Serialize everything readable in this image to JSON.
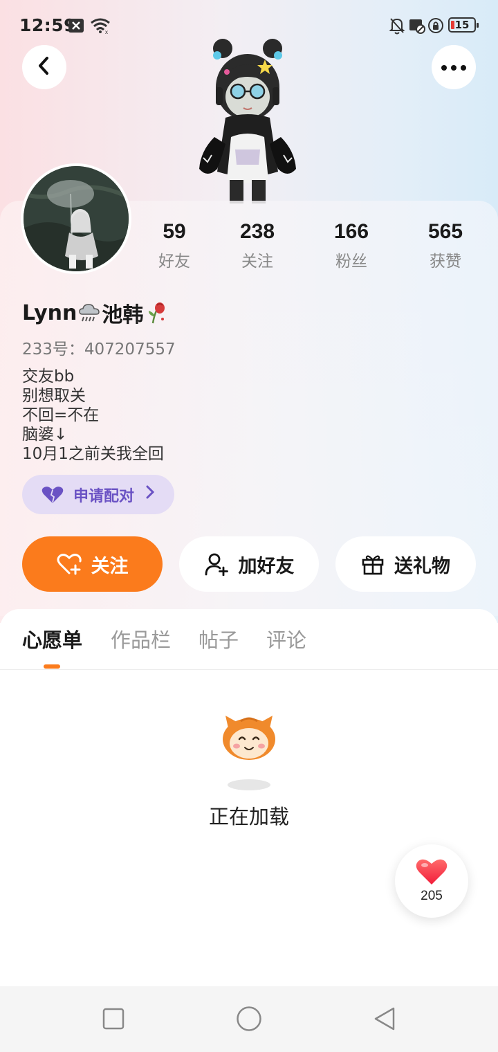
{
  "status_bar": {
    "time": "12:59",
    "battery_level": "15",
    "icons": [
      "close-box-icon",
      "wifi-icon",
      "mute-bell-icon",
      "screenshot-card-icon",
      "rotation-lock-icon",
      "battery-icon"
    ]
  },
  "header": {
    "back_icon": "chevron-left-icon",
    "more_icon": "more-dots-icon"
  },
  "profile": {
    "username": "Lynn",
    "username_suffix": "池韩",
    "id_text": "233号：407207557",
    "bio": [
      "交友bb",
      "别想取关",
      "不回=不在",
      "脑婆↓",
      "10月1之前关我全回"
    ],
    "pair_button": "申请配对"
  },
  "stats": [
    {
      "value": "59",
      "label": "好友"
    },
    {
      "value": "238",
      "label": "关注"
    },
    {
      "value": "166",
      "label": "粉丝"
    },
    {
      "value": "565",
      "label": "获赞"
    }
  ],
  "actions": {
    "follow": "关注",
    "add_friend": "加好友",
    "send_gift": "送礼物"
  },
  "tabs": [
    {
      "label": "心愿单",
      "active": true
    },
    {
      "label": "作品栏",
      "active": false
    },
    {
      "label": "帖子",
      "active": false
    },
    {
      "label": "评论",
      "active": false
    }
  ],
  "loading": {
    "text": "正在加载"
  },
  "like_float": {
    "count": "205"
  },
  "colors": {
    "accent": "#fb7b1c",
    "pair_bg": "#e4dcf5",
    "pair_text": "#6a52c4"
  }
}
